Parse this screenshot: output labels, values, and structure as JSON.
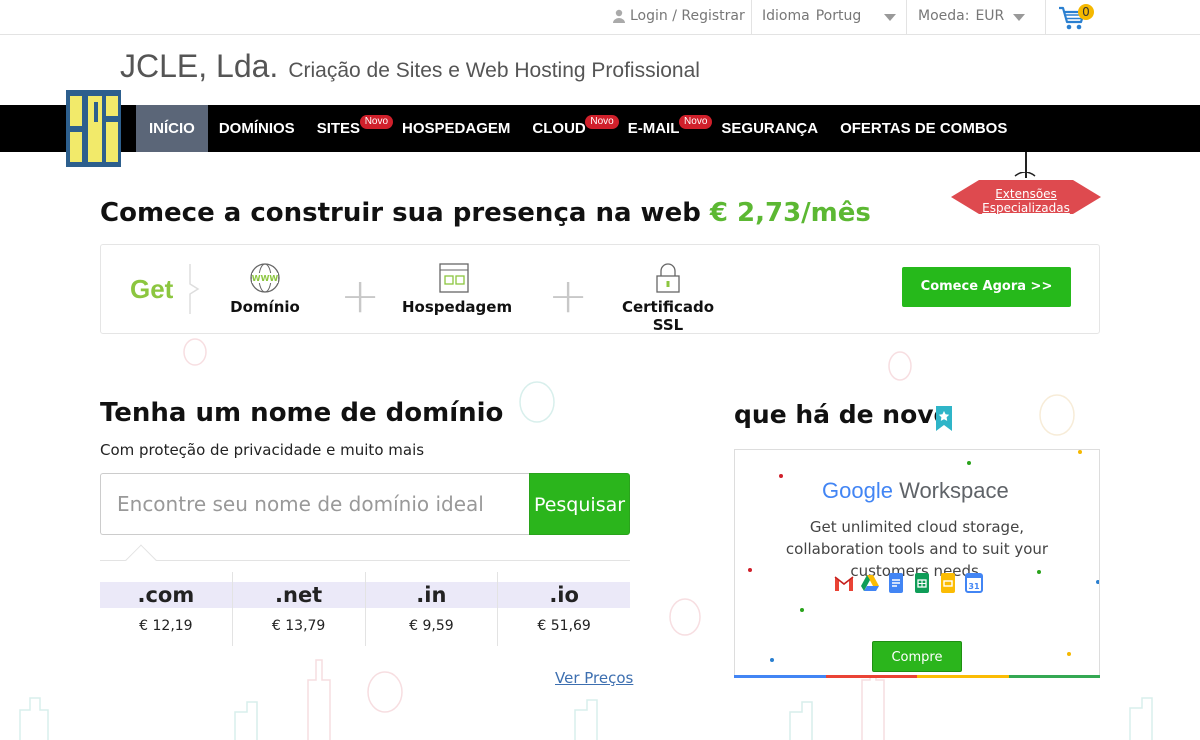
{
  "topbar": {
    "login": "Login / Registrar",
    "language_label": "Idioma",
    "language_value": "Portug",
    "currency_label": "Moeda:",
    "currency_value": "EUR",
    "cart_count": "0"
  },
  "header": {
    "company": "JCLE, Lda.",
    "tagline": "Criação de Sites e Web Hosting Profissional"
  },
  "nav": {
    "items": [
      {
        "label": "INÍCIO",
        "badge": ""
      },
      {
        "label": "DOMÍNIOS",
        "badge": ""
      },
      {
        "label": "SITES",
        "badge": "Novo"
      },
      {
        "label": "HOSPEDAGEM",
        "badge": ""
      },
      {
        "label": "CLOUD",
        "badge": "Novo"
      },
      {
        "label": "E-MAIL",
        "badge": "Novo"
      },
      {
        "label": "SEGURANÇA",
        "badge": ""
      },
      {
        "label": "OFERTAS DE COMBOS",
        "badge": ""
      }
    ]
  },
  "extension_tag": "Extensões Especializadas",
  "hero": {
    "title": "Comece a construir sua presença na web",
    "price": "€ 2,73/mês",
    "get": "Get",
    "features": [
      "Domínio",
      "Hospedagem",
      "Certificado SSL"
    ],
    "cta": "Comece Agora >>"
  },
  "domain": {
    "title": "Tenha um nome de domínio",
    "subtitle": "Com proteção de privacidade e muito mais",
    "placeholder": "Encontre seu nome de domínio ideal",
    "search_button": "Pesquisar",
    "tlds": [
      {
        "name": ".com",
        "price": "€ 12,19"
      },
      {
        "name": ".net",
        "price": "€ 13,79"
      },
      {
        "name": ".in",
        "price": "€ 9,59"
      },
      {
        "name": ".io",
        "price": "€ 51,69"
      }
    ],
    "see_prices": "Ver Preços"
  },
  "news": {
    "title": "que há de novo",
    "brand_google": "Google",
    "brand_product": "Workspace",
    "description": "Get unlimited cloud storage, collaboration tools and to suit your customers needs.",
    "buy_button": "Compre"
  },
  "colors": {
    "accent_green": "#26b91b",
    "price_green": "#5cb833",
    "nav_bg": "#000000",
    "nav_active": "#5b6678",
    "badge_red": "#d0202b"
  }
}
